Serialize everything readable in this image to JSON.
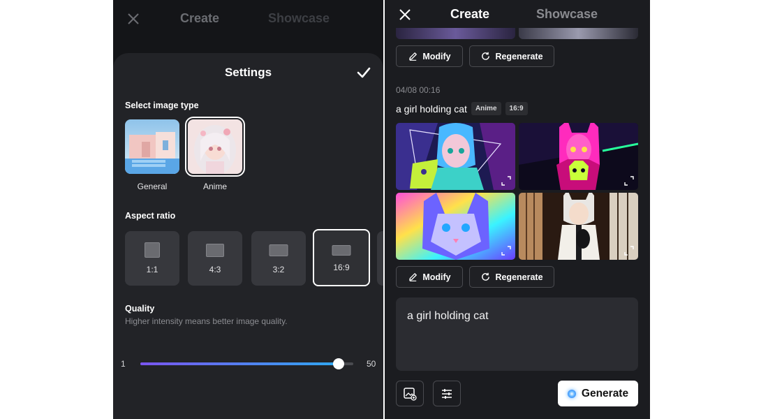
{
  "left": {
    "header": {
      "tab_create": "Create",
      "tab_showcase": "Showcase"
    },
    "settings": {
      "title": "Settings",
      "image_type_label": "Select image type",
      "image_types": [
        {
          "name": "General",
          "selected": false
        },
        {
          "name": "Anime",
          "selected": true
        }
      ],
      "aspect_ratio_label": "Aspect ratio",
      "aspect_ratios": [
        {
          "label": "1:1",
          "selected": false
        },
        {
          "label": "4:3",
          "selected": false
        },
        {
          "label": "3:2",
          "selected": false
        },
        {
          "label": "16:9",
          "selected": true
        }
      ],
      "quality": {
        "label": "Quality",
        "description": "Higher intensity means better image quality.",
        "min": "1",
        "max": "50",
        "value_fraction": 0.93
      }
    }
  },
  "right": {
    "header": {
      "tab_create": "Create",
      "tab_showcase": "Showcase"
    },
    "actions": {
      "modify": "Modify",
      "regenerate": "Regenerate"
    },
    "generation": {
      "timestamp": "04/08 00:16",
      "prompt": "a girl holding cat",
      "tags": [
        "Anime",
        "16:9"
      ]
    },
    "input": {
      "value": "a girl holding cat"
    },
    "generate_label": "Generate"
  },
  "colors": {
    "accent_gradient_start": "#7a55f0",
    "accent_gradient_end": "#2fa7f0",
    "background_left": "#141518",
    "background_right": "#1b1c20"
  }
}
